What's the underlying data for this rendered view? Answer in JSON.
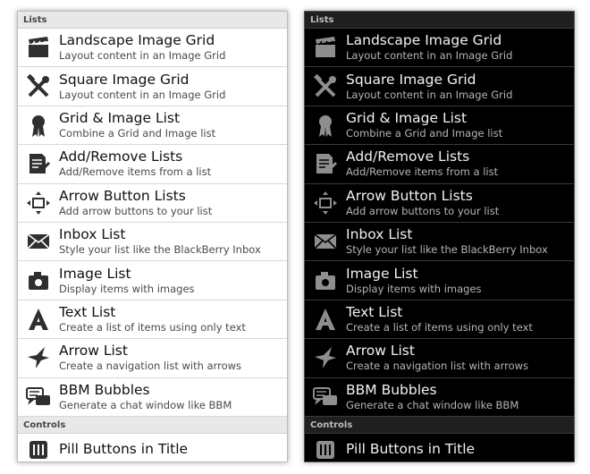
{
  "sections": {
    "lists": "Lists",
    "controls": "Controls"
  },
  "items": [
    {
      "title": "Landscape Image Grid",
      "subtitle": "Layout content in an Image Grid",
      "icon": "clapperboard-icon"
    },
    {
      "title": "Square Image Grid",
      "subtitle": "Layout content in an Image Grid",
      "icon": "tools-icon"
    },
    {
      "title": "Grid & Image List",
      "subtitle": "Combine a Grid and Image list",
      "icon": "ribbon-award-icon"
    },
    {
      "title": "Add/Remove Lists",
      "subtitle": "Add/Remove items from a list",
      "icon": "edit-document-icon"
    },
    {
      "title": "Arrow Button Lists",
      "subtitle": "Add arrow buttons to your list",
      "icon": "arrows-square-icon"
    },
    {
      "title": "Inbox List",
      "subtitle": "Style your list like the BlackBerry Inbox",
      "icon": "envelope-icon"
    },
    {
      "title": "Image List",
      "subtitle": "Display items with images",
      "icon": "camera-icon"
    },
    {
      "title": "Text List",
      "subtitle": "Create a list of items using only text",
      "icon": "letter-a-icon"
    },
    {
      "title": "Arrow List",
      "subtitle": "Create a navigation list with arrows",
      "icon": "bird-icon"
    },
    {
      "title": "BBM Bubbles",
      "subtitle": "Generate a chat window like BBM",
      "icon": "chat-bubbles-icon"
    }
  ],
  "controls_items": [
    {
      "title": "Pill Buttons in Title",
      "icon": "pill-buttons-icon"
    }
  ],
  "colors": {
    "light_background": "#ffffff",
    "dark_background": "#000000",
    "light_icon": "#2f2f2f",
    "dark_icon": "#8e8e8e"
  }
}
